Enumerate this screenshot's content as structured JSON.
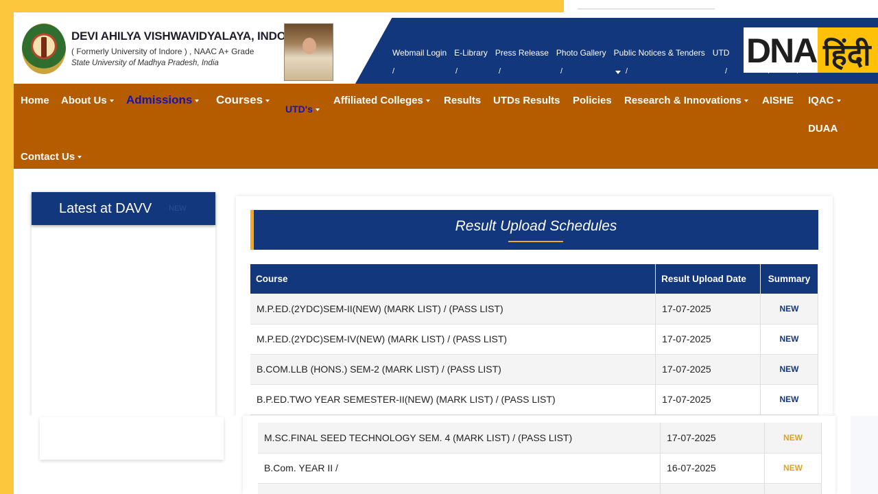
{
  "university": {
    "name": "DEVI AHILYA VISHWAVIDYALAYA, INDORE",
    "formerly": "( Formerly University of Indore ) , NAAC A+ Grade",
    "state": "State University of Madhya Pradesh, India"
  },
  "top_links": [
    "Webmail Login",
    "E-Library",
    "Press Release",
    "Photo Gallery",
    "Public Notices & Tenders",
    "UTD"
  ],
  "watermark": {
    "dna": "DNA",
    "hindi": "हिंदी"
  },
  "nav": {
    "home": "Home",
    "about": "About Us",
    "admissions": "Admissions",
    "courses": "Courses",
    "utds": "UTD's",
    "affiliated": "Affiliated Colleges",
    "results": "Results",
    "utds_results": "UTDs Results",
    "policies": "Policies",
    "research": "Research & Innovations",
    "aishe": "AISHE",
    "iqac": "IQAC",
    "duaa": "DUAA",
    "contact": "Contact Us"
  },
  "sidebar": {
    "title": "Latest at DAVV",
    "badge": "NEW"
  },
  "schedule": {
    "title": "Result Upload Schedules",
    "columns": [
      "Course",
      "Result Upload Date",
      "Summary"
    ],
    "rows": [
      {
        "course": "M.P.ED.(2YDC)SEM-II(NEW) (MARK LIST) / (PASS LIST)",
        "date": "17-07-2025",
        "summary": "NEW"
      },
      {
        "course": "M.P.ED.(2YDC)SEM-IV(NEW) (MARK LIST) / (PASS LIST)",
        "date": "17-07-2025",
        "summary": "NEW"
      },
      {
        "course": "B.COM.LLB (HONS.) SEM-2 (MARK LIST) / (PASS LIST)",
        "date": "17-07-2025",
        "summary": "NEW"
      },
      {
        "course": "B.P.ED.TWO YEAR SEMESTER-II(NEW) (MARK LIST) / (PASS LIST)",
        "date": "17-07-2025",
        "summary": "NEW"
      }
    ],
    "lower_rows": [
      {
        "course": "M.SC.FINAL SEED TECHNOLOGY SEM. 4 (MARK LIST) / (PASS LIST)",
        "date": "17-07-2025",
        "summary": "NEW"
      },
      {
        "course": "B.Com. YEAR II /",
        "date": "16-07-2025",
        "summary": "NEW"
      }
    ]
  },
  "colors": {
    "navy": "#12377c",
    "nav_orange": "#b65c00",
    "accent_yellow": "#fdc73d",
    "new_gold": "#e0a21a"
  }
}
